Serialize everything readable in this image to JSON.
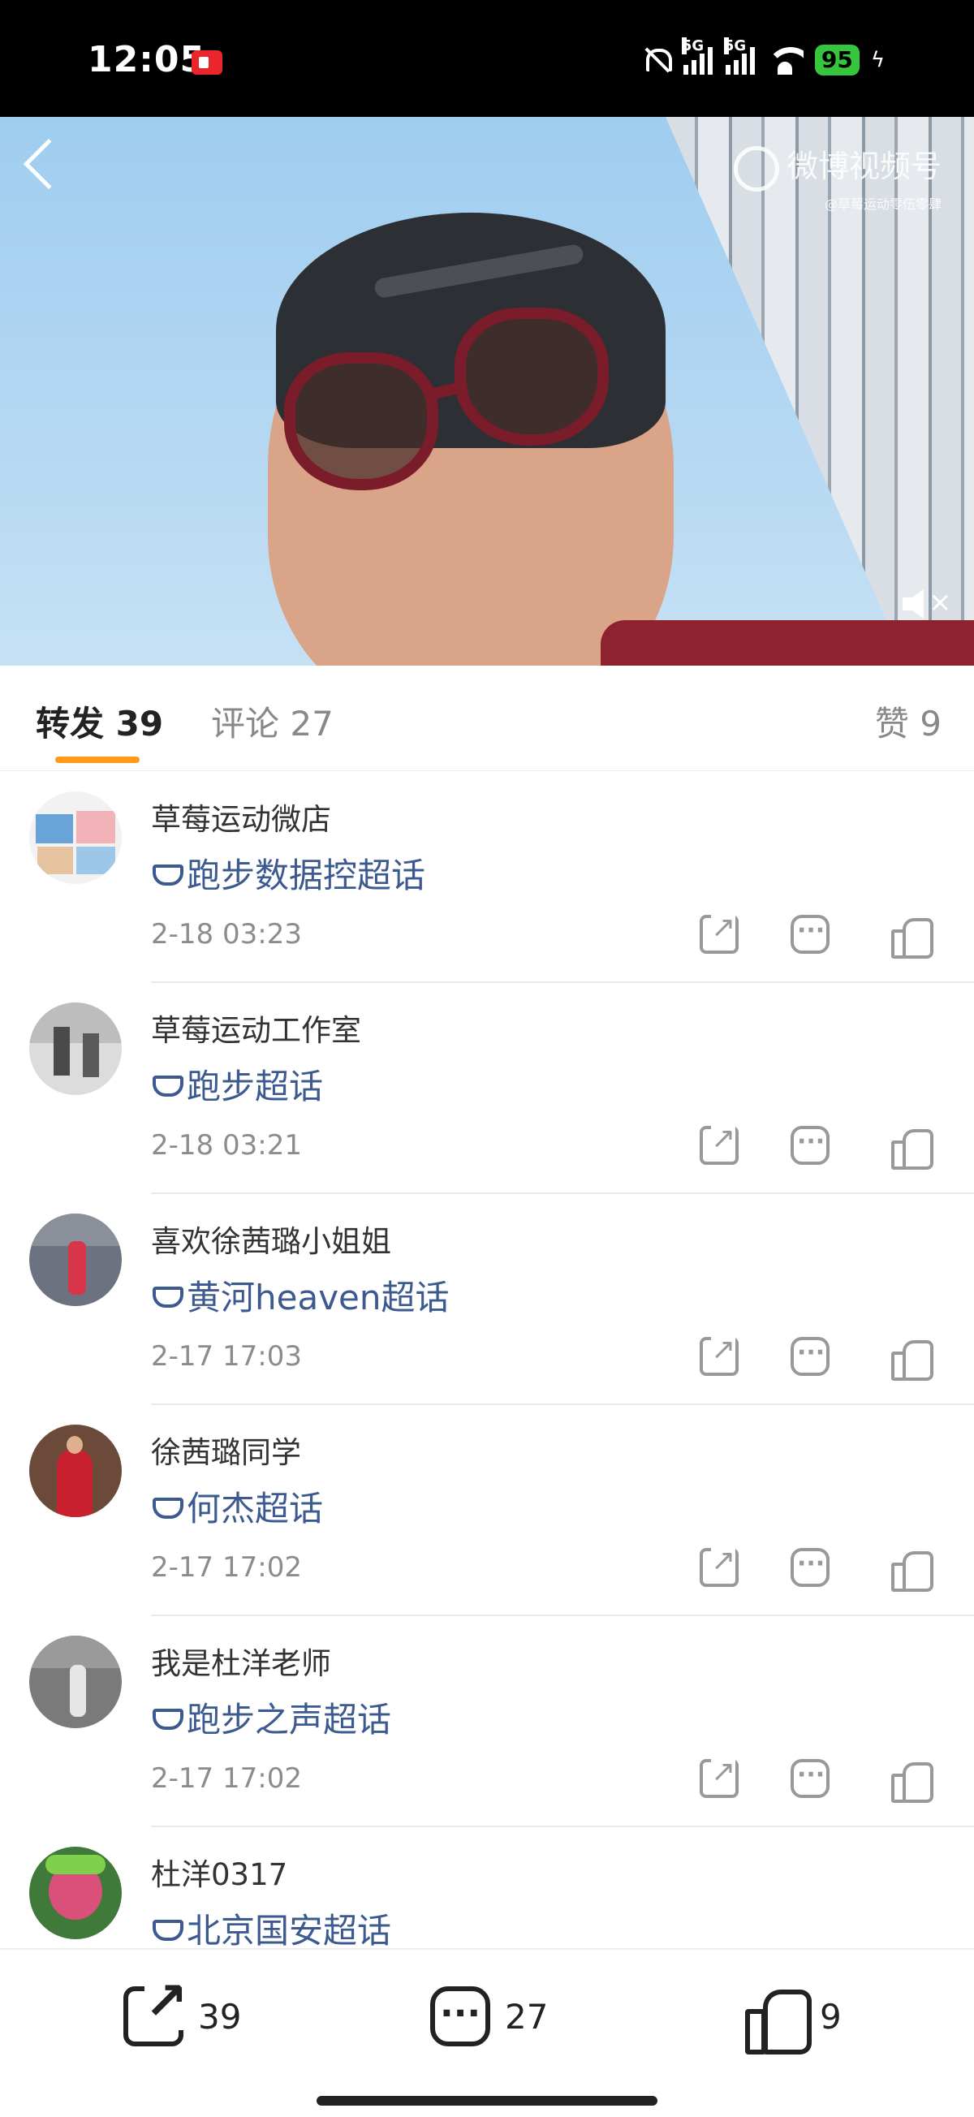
{
  "status_bar": {
    "time": "12:05",
    "network_1": "5G",
    "network_2": "5G",
    "battery": "95",
    "charging_icon": "bolt-icon"
  },
  "video": {
    "watermark_main": "微博视频号",
    "watermark_sub": "@草莓运动零伍零肆"
  },
  "tabs": {
    "repost": "转发 39",
    "comment": "评论 27",
    "like": "赞 9"
  },
  "reposts": [
    {
      "user": "草莓运动微店",
      "topic": "跑步数据控超话",
      "time": "2-18 03:23"
    },
    {
      "user": "草莓运动工作室",
      "topic": "跑步超话",
      "time": "2-18 03:21"
    },
    {
      "user": "喜欢徐茜璐小姐姐",
      "topic": "黄河heaven超话",
      "time": "2-17 17:03"
    },
    {
      "user": "徐茜璐同学",
      "topic": "何杰超话",
      "time": "2-17 17:02"
    },
    {
      "user": "我是杜洋老师",
      "topic": "跑步之声超话",
      "time": "2-17 17:02"
    },
    {
      "user": "杜洋0317",
      "topic": "北京国安超话",
      "time": ""
    }
  ],
  "bottom_bar": {
    "repost_count": "39",
    "comment_count": "27",
    "like_count": "9"
  },
  "colors": {
    "accent": "#ff9a1a",
    "topic_link": "#3c5a90",
    "battery": "#35c63d"
  }
}
